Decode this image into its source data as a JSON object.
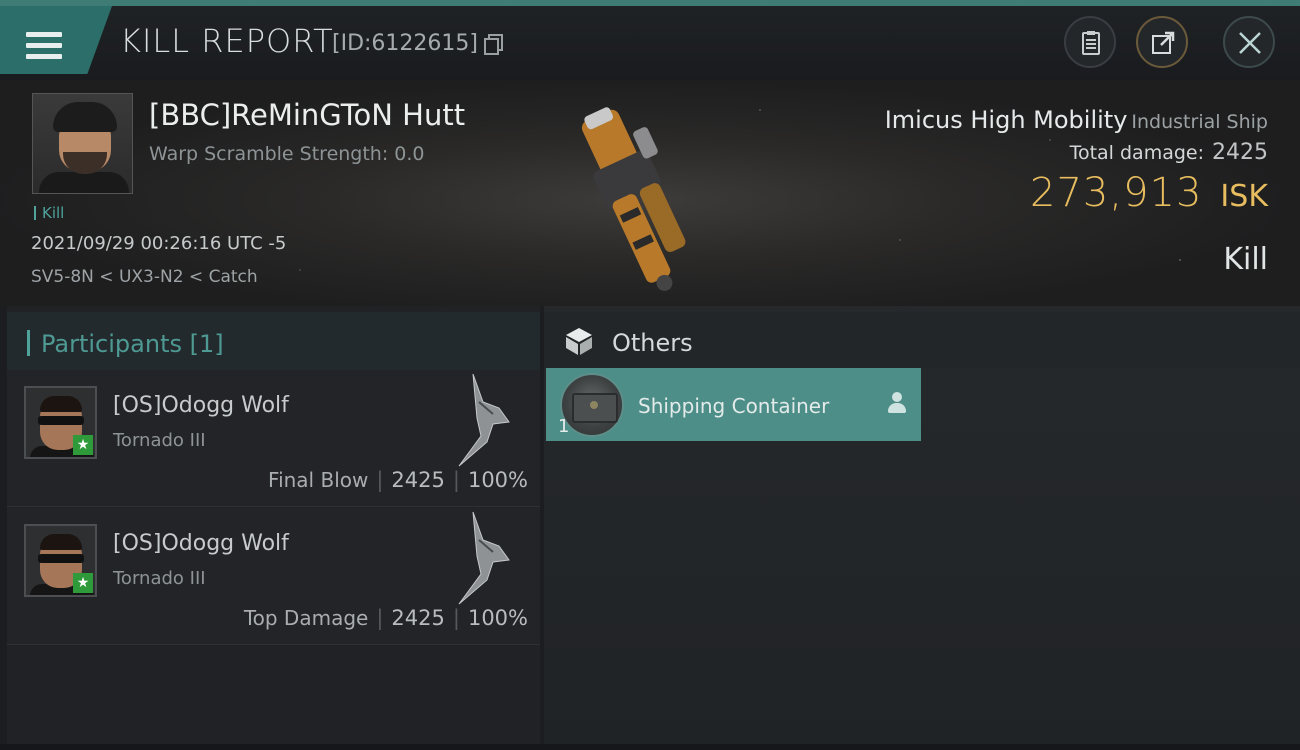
{
  "header": {
    "title": "KILL REPORT",
    "report_id": "[ID:6122615]",
    "icons": [
      "menu-icon",
      "copy-icon",
      "clipboard-icon",
      "share-icon",
      "close-icon"
    ]
  },
  "victim": {
    "name": "[BBC]ReMinGToN Hutt",
    "warp_scramble": "Warp Scramble Strength: 0.0",
    "kill_tag": "Kill",
    "datetime": "2021/09/29 00:26:16 UTC -5",
    "location": "SV5-8N < UX3-N2 < Catch",
    "ship_name": "Imicus High Mobility",
    "ship_class": "Industrial Ship",
    "total_damage_label": "Total damage:",
    "total_damage_value": "2425",
    "isk_value": "273,913",
    "isk_unit": "ISK",
    "result": "Kill"
  },
  "participants": {
    "title": "Participants [1]",
    "rows": [
      {
        "name": "[OS]Odogg Wolf",
        "ship": "Tornado III",
        "label": "Final Blow",
        "damage": "2425",
        "percent": "100%"
      },
      {
        "name": "[OS]Odogg Wolf",
        "ship": "Tornado III",
        "label": "Top Damage",
        "damage": "2425",
        "percent": "100%"
      }
    ]
  },
  "others": {
    "title": "Others",
    "items": [
      {
        "name": "Shipping Container",
        "quantity": "1"
      }
    ]
  },
  "colors": {
    "accent_teal": "#4fa39b",
    "isk_gold": "#e8bd5f",
    "item_highlight": "#4d8f88"
  }
}
